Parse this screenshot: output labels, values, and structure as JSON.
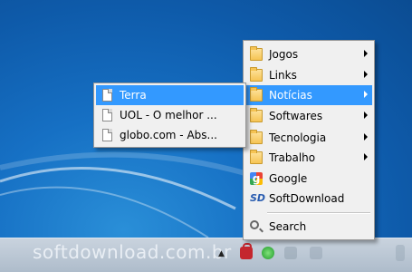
{
  "watermark": "softdownload.com.br",
  "main_menu": {
    "items": [
      {
        "label": "Jogos",
        "icon": "folder-icon",
        "submenu": true
      },
      {
        "label": "Links",
        "icon": "folder-icon",
        "submenu": true
      },
      {
        "label": "Notícias",
        "icon": "folder-icon",
        "submenu": true,
        "highlighted": true
      },
      {
        "label": "Softwares",
        "icon": "folder-icon",
        "submenu": true
      },
      {
        "label": "Tecnologia",
        "icon": "folder-icon",
        "submenu": true
      },
      {
        "label": "Trabalho",
        "icon": "folder-icon",
        "submenu": true
      },
      {
        "label": "Google",
        "icon": "google-icon"
      },
      {
        "label": "SoftDownload",
        "icon": "softdownload-icon"
      }
    ],
    "search_label": "Search"
  },
  "sub_menu": {
    "items": [
      {
        "label": "Terra",
        "icon": "page-icon",
        "highlighted": true
      },
      {
        "label": "UOL - O melhor ...",
        "icon": "page-icon"
      },
      {
        "label": "globo.com - Abs...",
        "icon": "page-icon"
      }
    ]
  },
  "colors": {
    "highlight": "#3399ff",
    "menu_bg": "#f0f0f0",
    "desktop": "#1670c4"
  }
}
